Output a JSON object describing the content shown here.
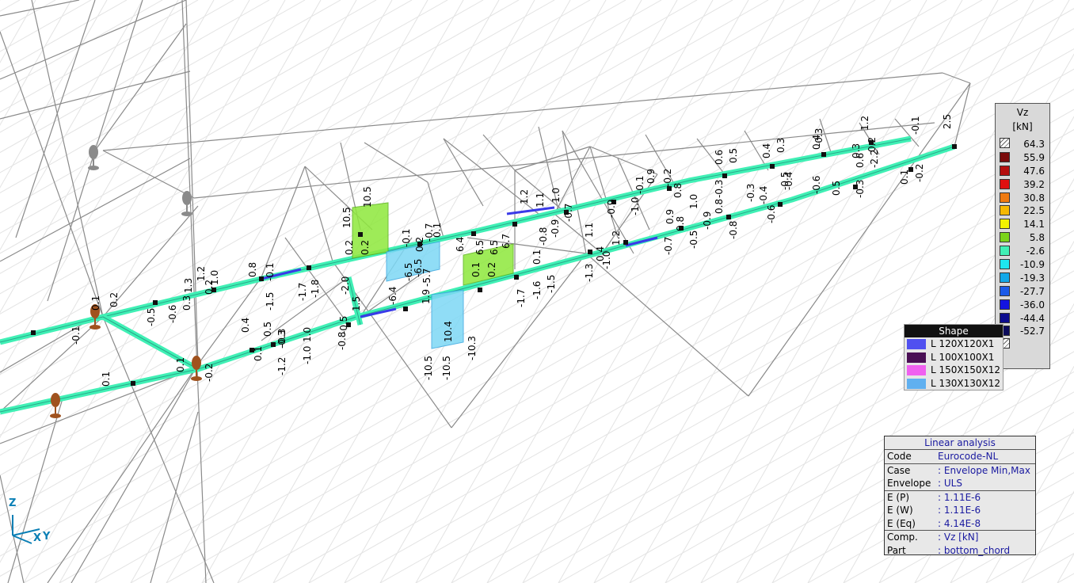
{
  "legend": {
    "title_line1": "Vz",
    "title_line2": "[kN]",
    "items": [
      {
        "value": "64.3",
        "color": "#ffffff",
        "hatch": true
      },
      {
        "value": "55.9",
        "color": "#7a0a0a"
      },
      {
        "value": "47.6",
        "color": "#b50e0e"
      },
      {
        "value": "39.2",
        "color": "#e01010"
      },
      {
        "value": "30.8",
        "color": "#f07a10"
      },
      {
        "value": "22.5",
        "color": "#f5b800"
      },
      {
        "value": "14.1",
        "color": "#f2f200"
      },
      {
        "value": "5.8",
        "color": "#7ad31a"
      },
      {
        "value": "-2.6",
        "color": "#40f0b5"
      },
      {
        "value": "-10.9",
        "color": "#1ee6f0"
      },
      {
        "value": "-19.3",
        "color": "#12a8e8"
      },
      {
        "value": "-27.7",
        "color": "#1a5ae8"
      },
      {
        "value": "-36.0",
        "color": "#1414e0"
      },
      {
        "value": "-44.4",
        "color": "#0b0b8e"
      },
      {
        "value": "-52.7",
        "color": "#0a0a5a"
      },
      {
        "value": "",
        "color": "#ffffff",
        "hatch": true
      }
    ]
  },
  "shape_legend": {
    "title": "Shape",
    "items": [
      {
        "label": "L 120X120X1",
        "color": "#5050f0"
      },
      {
        "label": "L 100X100X1",
        "color": "#4a0f55"
      },
      {
        "label": "L 150X150X12",
        "color": "#f060f0"
      },
      {
        "label": "L 130X130X12",
        "color": "#60b0f0"
      }
    ]
  },
  "analysis": {
    "title": "Linear analysis",
    "rows": [
      {
        "key": "Code",
        "value": "Eurocode-NL"
      },
      {
        "key": "Case",
        "value": ": Envelope Min,Max",
        "sep": true
      },
      {
        "key": "Envelope",
        "value": ": ULS"
      },
      {
        "key": "E (P)",
        "value": ": 1.11E-6",
        "sep": true
      },
      {
        "key": "E (W)",
        "value": ": 1.11E-6"
      },
      {
        "key": "E (Eq)",
        "value": ": 4.14E-8"
      },
      {
        "key": "Comp.",
        "value": ": Vz [kN]",
        "sep": true
      },
      {
        "key": "Part",
        "value": ": bottom_chord"
      }
    ]
  },
  "axes": {
    "z": "Z",
    "y": "Y",
    "x": "X"
  },
  "diagram_labels": [
    "-0.1",
    "0.1",
    "0.2",
    "-0.5",
    "-0.6",
    "0.3",
    "1.3",
    "1.2",
    "0.2",
    "1.0",
    "0.1",
    "-0.2",
    "0.1",
    "0.8",
    "-0.1",
    "-1.5",
    "-0.3",
    "-1.8",
    "-1.7",
    "0.4",
    "0.1",
    "0.5",
    "-0.3",
    "-1.2",
    "-1.0",
    "1.0",
    "-2.0",
    "0.2",
    "10.5",
    "10.5",
    "0.2",
    "1.5",
    "-0.5",
    "-0.8",
    "-6.4",
    "-0.1",
    "-6.5",
    "-6.5",
    "0.2",
    "-0.7",
    "0.1",
    "1.9",
    "-5.7",
    "6.4",
    "-10.5",
    "-10.5",
    "10.4",
    "-10.3",
    "0.1",
    "0.2",
    "6.5",
    "6.5",
    "6.7",
    "-1.7",
    "-1.6",
    "-1.5",
    "0.1",
    "-0.8",
    "1.2",
    "1.1",
    "1.0",
    "-0.9",
    "-0.7",
    "1.1",
    "-1.3",
    "-1.0",
    "1.2",
    "0.4",
    "-0.9",
    "-1.0",
    "-0.1",
    "0.9",
    "-0.2",
    "0.8",
    "-0.7",
    "0.9",
    "0.8",
    "-0.5",
    "1.0",
    "-0.9",
    "0.8",
    "-0.8",
    "-0.3",
    "0.6",
    "0.5",
    "-0.3",
    "-0.6",
    "-0.4",
    "0.4",
    "-0.5",
    "0.3",
    "-0.4",
    "-0.6",
    "0.4",
    "0.5",
    "-0.3",
    "-0.3",
    "0.6",
    "0.3",
    "-2.2",
    "0.2",
    "1.2",
    "0.1",
    "-0.2",
    "-0.1",
    "2.5",
    "1.6"
  ]
}
